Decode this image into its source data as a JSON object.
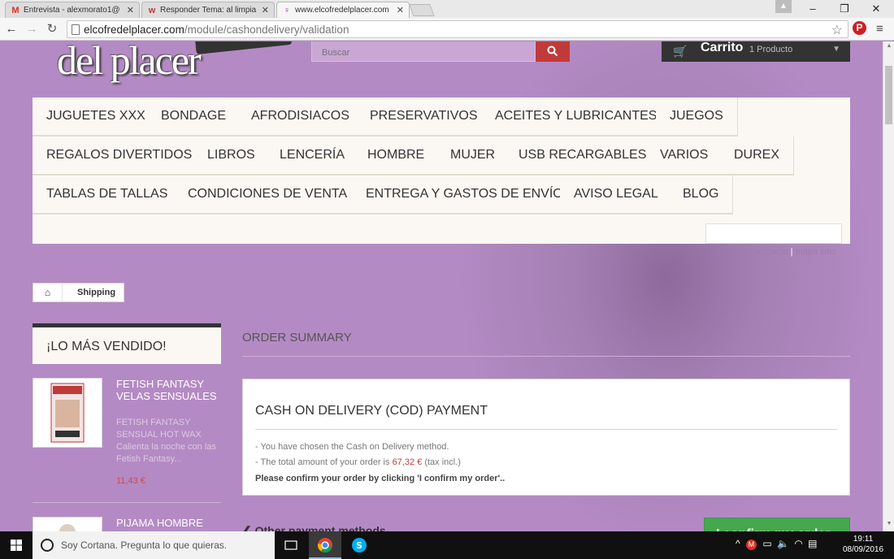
{
  "browser": {
    "tabs": [
      {
        "title": "Entrevista - alexmorato1@",
        "favicon": "M",
        "favicon_color": "#d93025"
      },
      {
        "title": "Responder Tema: al limpia",
        "favicon": "w",
        "favicon_color": "#c13a3a"
      },
      {
        "title": "www.elcofredelplacer.com",
        "favicon": "♀",
        "favicon_color": "#9b27b0"
      }
    ],
    "active_tab": 2,
    "url_host": "elcofredelplacer.com",
    "url_path": "/module/cashondelivery/validation"
  },
  "header": {
    "logo_text": "del placer",
    "search_placeholder": "Buscar",
    "cart_label": "Carrito",
    "cart_count": "1 Producto"
  },
  "menu": {
    "rows": [
      [
        "Juguetes XXX",
        "Bondage",
        "Afrodisiacos",
        "Preservativos",
        "Aceites y lubricantes",
        "Juegos"
      ],
      [
        "Regalos divertidos",
        "Libros",
        "Lencería",
        "Hombre",
        "Mujer",
        "USB recargables",
        "Varios",
        "Durex"
      ],
      [
        "Tablas de tallas",
        "Condiciones de venta",
        "Entrega y gastos de envío",
        "Aviso legal",
        "Blog"
      ]
    ],
    "toplinks": {
      "contact": "contacto",
      "sitemap": "mapa sitio"
    }
  },
  "breadcrumb": {
    "current": "Shipping"
  },
  "sidebar": {
    "title": "¡Lo más vendido!",
    "products": [
      {
        "name": "Fetish Fantasy Velas Sensuales",
        "description": "FETISH FANTASY SENSUAL HOT WAX Calienta la noche con las Fetish Fantasy...",
        "price": "11,43 €"
      },
      {
        "name": "Pijama hombre sexy",
        "description": "",
        "price": ""
      }
    ]
  },
  "main": {
    "heading": "Order summary",
    "box_title": "Cash on delivery (COD) payment",
    "line1": "- You have chosen the Cash on Delivery method.",
    "line2_prefix": "- The total amount of your order is",
    "amount": "67,32 €",
    "line2_suffix": "(tax incl.)",
    "line3": "Please confirm your order by clicking 'I confirm my order'..",
    "other_payment": "Other payment methods",
    "confirm_button": "I confirm my order"
  },
  "taskbar": {
    "cortana_text": "Soy Cortana. Pregunta lo que quieras.",
    "time": "19:11",
    "date": "08/09/2016"
  }
}
